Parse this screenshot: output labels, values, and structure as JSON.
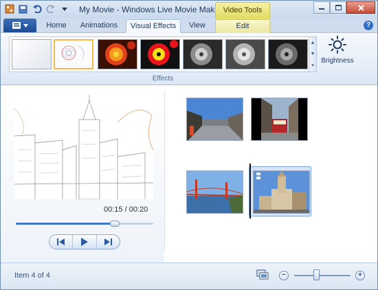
{
  "window": {
    "title": "My Movie - Windows Live Movie Maker",
    "context_tab": "Video Tools"
  },
  "tabs": [
    {
      "label": "Home"
    },
    {
      "label": "Animations"
    },
    {
      "label": "Visual Effects",
      "active": true
    },
    {
      "label": "View"
    },
    {
      "label": "Edit"
    }
  ],
  "ribbon": {
    "effects": [
      {
        "name": "No effect"
      },
      {
        "name": "Edge detection",
        "selected": true
      },
      {
        "name": "Threshold warm"
      },
      {
        "name": "Threshold red"
      },
      {
        "name": "Black and white"
      },
      {
        "name": "Black and white light"
      },
      {
        "name": "Black and white dark"
      }
    ],
    "group_label": "Effects",
    "brightness_label": "Brightness"
  },
  "preview": {
    "time": "00:15 / 00:20",
    "seek_fraction": 0.72
  },
  "storyboard": {
    "clips": [
      {
        "name": "street-clip"
      },
      {
        "name": "cable-car-clip"
      },
      {
        "name": "golden-gate-clip"
      },
      {
        "name": "church-clip",
        "selected": true
      }
    ]
  },
  "status": {
    "item_text": "Item 4 of 4",
    "zoom_fraction": 0.4
  },
  "colors": {
    "ribbon_accent": "#3e79c8",
    "context_tab": "#e2dc63",
    "selection": "#f2b84b"
  },
  "icons": [
    "app-icon",
    "save-icon",
    "undo-icon",
    "redo-icon",
    "customize-icon",
    "minimize-icon",
    "maximize-icon",
    "close-icon",
    "help-icon",
    "brightness-icon",
    "previous-frame-icon",
    "play-icon",
    "next-frame-icon",
    "monitor-icon",
    "zoom-out-icon",
    "zoom-in-icon"
  ]
}
